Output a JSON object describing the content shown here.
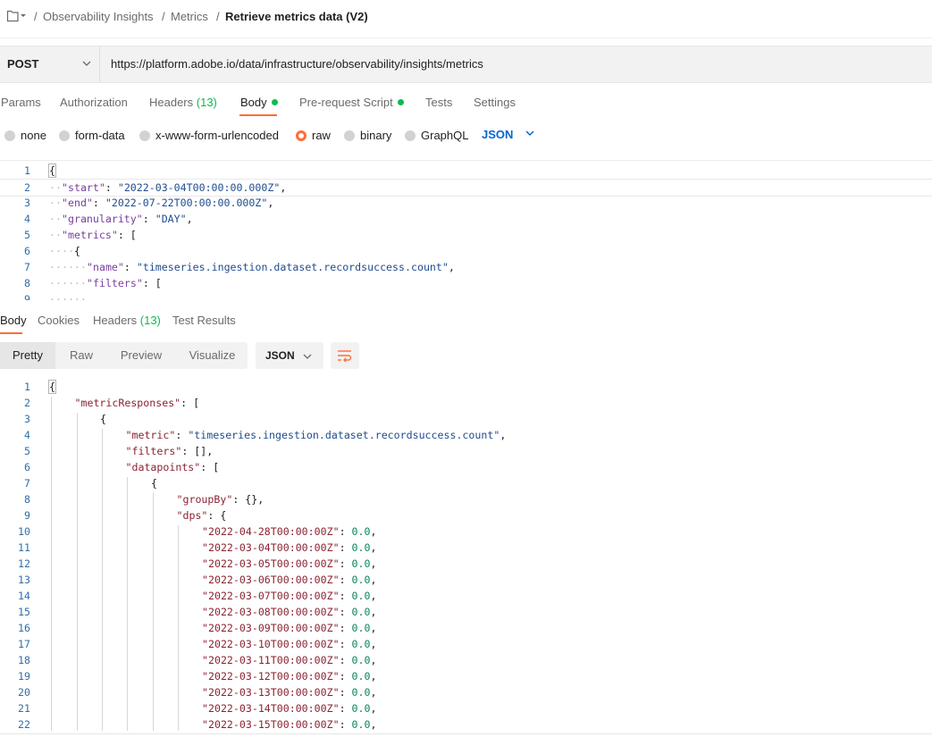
{
  "breadcrumb": {
    "separator": "/",
    "items": [
      "Observability Insights",
      "Metrics",
      "Retrieve metrics data (V2)"
    ]
  },
  "request": {
    "method": "POST",
    "url": "https://platform.adobe.io/data/infrastructure/observability/insights/metrics"
  },
  "request_tabs": {
    "params": "Params",
    "authorization": "Authorization",
    "headers": "Headers",
    "headers_count": "(13)",
    "body": "Body",
    "prerequest": "Pre-request Script",
    "tests": "Tests",
    "settings": "Settings"
  },
  "body_types": {
    "none": "none",
    "form_data": "form-data",
    "urlencoded": "x-www-form-urlencoded",
    "raw": "raw",
    "binary": "binary",
    "graphql": "GraphQL",
    "format": "JSON",
    "selected": "raw"
  },
  "request_body": {
    "lines": [
      {
        "n": "1",
        "c": "{"
      },
      {
        "n": "2",
        "key": "\"start\"",
        "val": "\"2022-03-04T00:00:00.000Z\"",
        "tail": ","
      },
      {
        "n": "3",
        "key": "\"end\"",
        "val": "\"2022-07-22T00:00:00.000Z\"",
        "tail": ","
      },
      {
        "n": "4",
        "key": "\"granularity\"",
        "val": "\"DAY\"",
        "tail": ","
      },
      {
        "n": "5",
        "key": "\"metrics\"",
        "tail": "["
      },
      {
        "n": "6",
        "c": "{"
      },
      {
        "n": "7",
        "key": "\"name\"",
        "val": "\"timeseries.ingestion.dataset.recordsuccess.count\"",
        "tail": ","
      },
      {
        "n": "8",
        "key": "\"filters\"",
        "tail": "["
      },
      {
        "n": "9",
        "c": ""
      }
    ]
  },
  "response_tabs": {
    "body": "Body",
    "cookies": "Cookies",
    "headers": "Headers",
    "headers_count": "(13)",
    "test_results": "Test Results"
  },
  "response_view": {
    "pretty": "Pretty",
    "raw": "Raw",
    "preview": "Preview",
    "visualize": "Visualize",
    "format": "JSON"
  },
  "response_body": {
    "lines": [
      {
        "n": "1",
        "c": "{"
      },
      {
        "n": "2",
        "key": "\"metricResponses\"",
        "tail": "["
      },
      {
        "n": "3",
        "c": "{"
      },
      {
        "n": "4",
        "key": "\"metric\"",
        "val": "\"timeseries.ingestion.dataset.recordsuccess.count\"",
        "tail": ","
      },
      {
        "n": "5",
        "key": "\"filters\"",
        "tail": "[],"
      },
      {
        "n": "6",
        "key": "\"datapoints\"",
        "tail": "["
      },
      {
        "n": "7",
        "c": "{"
      },
      {
        "n": "8",
        "key": "\"groupBy\"",
        "tail": "{},"
      },
      {
        "n": "9",
        "key": "\"dps\"",
        "tail": "{"
      },
      {
        "n": "10",
        "key": "\"2022-04-28T00:00:00Z\"",
        "num": "0.0",
        "tail": ","
      },
      {
        "n": "11",
        "key": "\"2022-03-04T00:00:00Z\"",
        "num": "0.0",
        "tail": ","
      },
      {
        "n": "12",
        "key": "\"2022-03-05T00:00:00Z\"",
        "num": "0.0",
        "tail": ","
      },
      {
        "n": "13",
        "key": "\"2022-03-06T00:00:00Z\"",
        "num": "0.0",
        "tail": ","
      },
      {
        "n": "14",
        "key": "\"2022-03-07T00:00:00Z\"",
        "num": "0.0",
        "tail": ","
      },
      {
        "n": "15",
        "key": "\"2022-03-08T00:00:00Z\"",
        "num": "0.0",
        "tail": ","
      },
      {
        "n": "16",
        "key": "\"2022-03-09T00:00:00Z\"",
        "num": "0.0",
        "tail": ","
      },
      {
        "n": "17",
        "key": "\"2022-03-10T00:00:00Z\"",
        "num": "0.0",
        "tail": ","
      },
      {
        "n": "18",
        "key": "\"2022-03-11T00:00:00Z\"",
        "num": "0.0",
        "tail": ","
      },
      {
        "n": "19",
        "key": "\"2022-03-12T00:00:00Z\"",
        "num": "0.0",
        "tail": ","
      },
      {
        "n": "20",
        "key": "\"2022-03-13T00:00:00Z\"",
        "num": "0.0",
        "tail": ","
      },
      {
        "n": "21",
        "key": "\"2022-03-14T00:00:00Z\"",
        "num": "0.0",
        "tail": ","
      },
      {
        "n": "22",
        "key": "\"2022-03-15T00:00:00Z\"",
        "num": "0.0",
        "tail": ","
      }
    ]
  },
  "colors": {
    "accent": "#ff6c37",
    "success": "#0cbb52",
    "link": "#0265d2"
  },
  "icons": {
    "collection": "collection-icon",
    "method_dropdown": "chevron-down-icon",
    "format_dropdown": "chevron-down-icon",
    "wrap": "wrap-lines-icon"
  }
}
